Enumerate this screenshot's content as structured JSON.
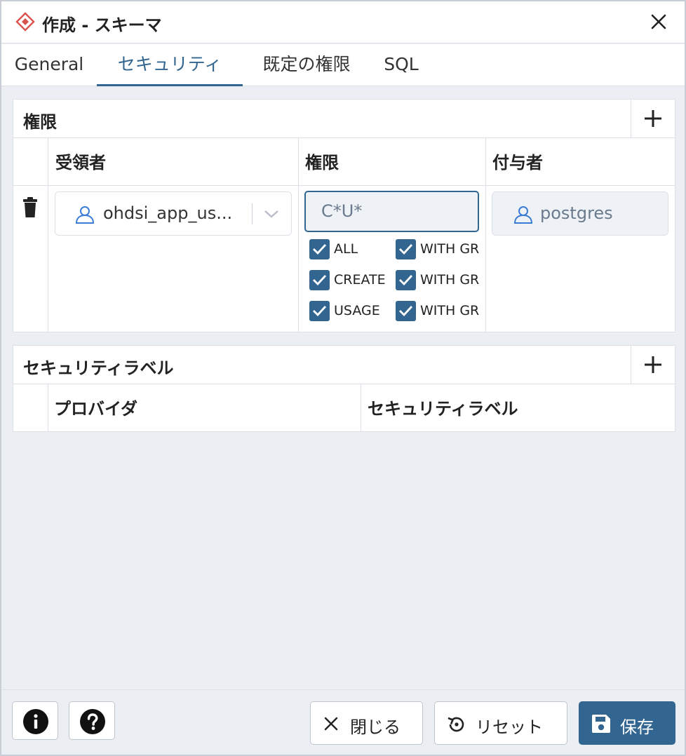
{
  "dialog": {
    "title": "作成 - スキーマ"
  },
  "tabs": [
    {
      "label": "General",
      "active": false
    },
    {
      "label": "セキュリティ",
      "active": true
    },
    {
      "label": "既定の権限",
      "active": false
    },
    {
      "label": "SQL",
      "active": false
    }
  ],
  "privileges": {
    "title": "権限",
    "columns": {
      "grantee": "受領者",
      "privileges": "権限",
      "grantor": "付与者"
    },
    "row": {
      "grantee": "ohdsi_app_us...",
      "privilege_value": "C*U*",
      "checkboxes": [
        {
          "label": "ALL",
          "checked": true,
          "grant_label": "WITH GR",
          "grant_checked": true
        },
        {
          "label": "CREATE",
          "checked": true,
          "grant_label": "WITH GR",
          "grant_checked": true
        },
        {
          "label": "USAGE",
          "checked": true,
          "grant_label": "WITH GR",
          "grant_checked": true
        }
      ],
      "grantor": "postgres"
    }
  },
  "security_labels": {
    "title": "セキュリティラベル",
    "columns": {
      "provider": "プロバイダ",
      "label": "セキュリティラベル"
    }
  },
  "footer": {
    "close_label": "閉じる",
    "reset_label": "リセット",
    "save_label": "保存"
  },
  "colors": {
    "accent": "#326690",
    "danger_icon": "#d9534f",
    "background": "#ebeef3"
  },
  "icons": [
    "schema-icon",
    "close-icon",
    "plus-icon",
    "trash-icon",
    "user-icon",
    "chevron-down-icon",
    "check-icon",
    "info-icon",
    "help-icon",
    "x-icon",
    "reset-icon",
    "save-icon"
  ]
}
